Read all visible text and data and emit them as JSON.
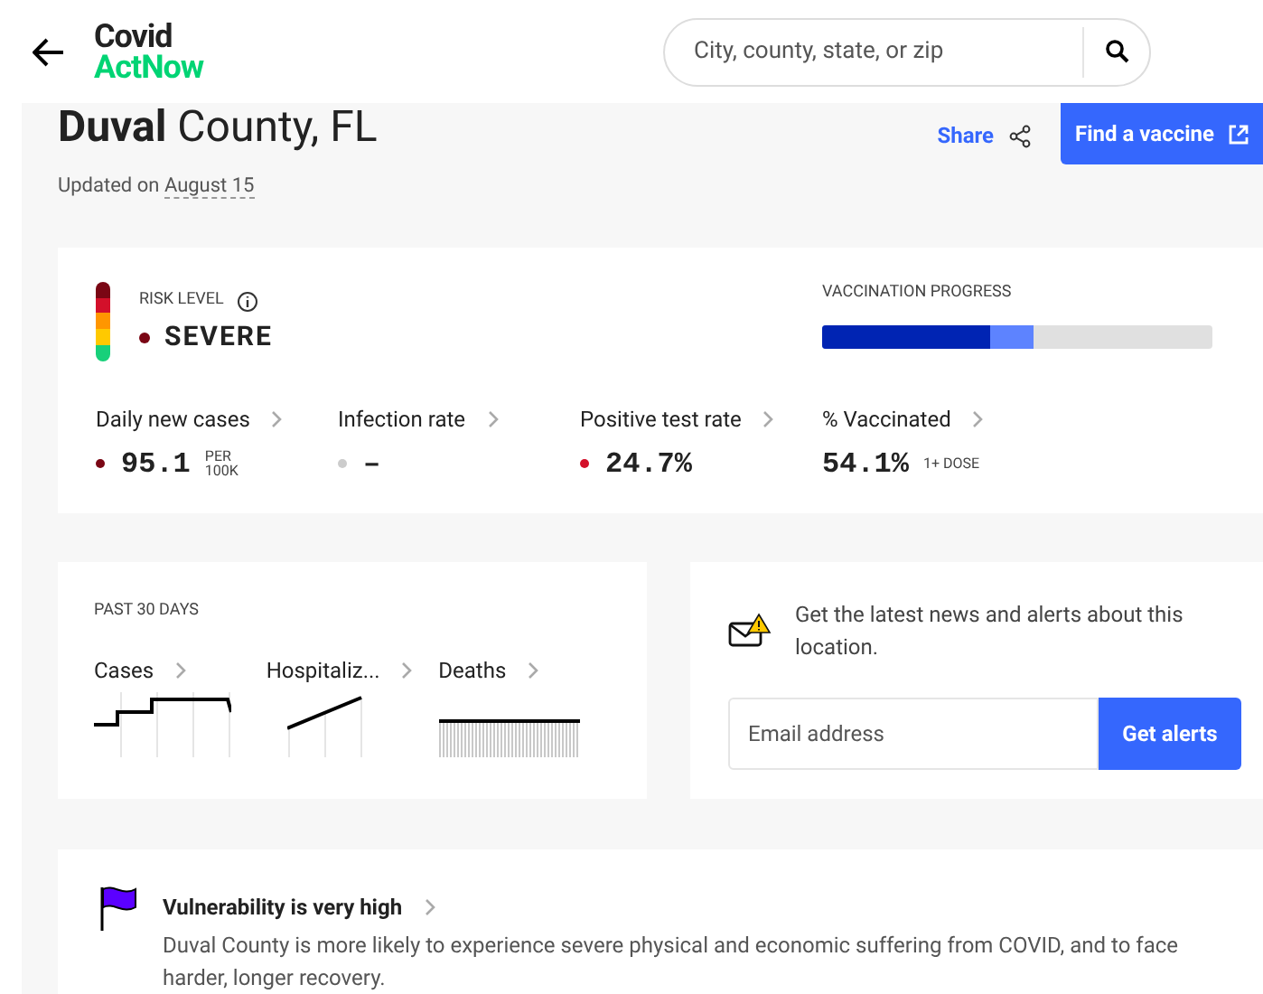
{
  "header": {
    "logo_top": "Covid",
    "logo_bottom": "ActNow",
    "search": {
      "placeholder": "City, county, state, or zip"
    }
  },
  "title": {
    "bold": "Duval",
    "rest": "County, FL"
  },
  "updated": {
    "label": "Updated on",
    "date": "August 15"
  },
  "share": "Share",
  "vaccine_button": "Find a vaccine",
  "risk": {
    "label": "RISK LEVEL",
    "value": "SEVERE",
    "color": "#7a0614"
  },
  "vaccination": {
    "label": "VACCINATION PROGRESS",
    "segments": [
      {
        "level": 0.43,
        "color": "#0024b3"
      },
      {
        "level": 0.54,
        "color": "#5d83ff"
      }
    ]
  },
  "metrics": [
    {
      "label": "Daily new cases",
      "value": "95.1",
      "unit": [
        "PER",
        "100K"
      ],
      "color": "#7a0614"
    },
    {
      "label": "Infection rate",
      "value": "–",
      "color": "#cccccc"
    },
    {
      "label": "Positive test rate",
      "value": "24.7%",
      "color": "#d3102a"
    },
    {
      "label": "% Vaccinated",
      "value": "54.1%",
      "unit": [
        "1+ DOSE"
      ]
    }
  ],
  "past": {
    "label": "PAST 30 DAYS",
    "items": [
      {
        "label": "Cases",
        "kind": "steps"
      },
      {
        "label": "Hospitaliz...",
        "kind": "rising"
      },
      {
        "label": "Deaths",
        "kind": "flat"
      }
    ]
  },
  "alerts": {
    "text": "Get the latest news and alerts about this location.",
    "email": {
      "placeholder": "Email address"
    },
    "button": "Get alerts"
  },
  "vulnerability": {
    "title": "Vulnerability is very high",
    "text": "Duval County is more likely to experience severe physical and economic suffering from COVID, and to face harder, longer recovery.",
    "color": "#5b00ff"
  }
}
